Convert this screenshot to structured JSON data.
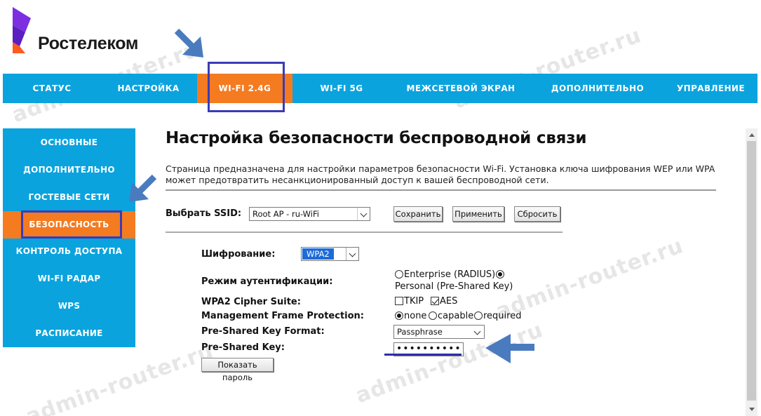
{
  "brand": {
    "name": "Ростелеком"
  },
  "topnav": {
    "items": [
      {
        "label": "СТАТУС"
      },
      {
        "label": "НАСТРОЙКА"
      },
      {
        "label": "WI-FI 2.4G"
      },
      {
        "label": "WI-FI 5G"
      },
      {
        "label": "МЕЖСЕТЕВОЙ ЭКРАН"
      },
      {
        "label": "ДОПОЛНИТЕЛЬНО"
      },
      {
        "label": "УПРАВЛЕНИЕ"
      }
    ],
    "active_index": 2
  },
  "sidebar": {
    "items": [
      {
        "label": "ОСНОВНЫЕ"
      },
      {
        "label": "ДОПОЛНИТЕЛЬНО"
      },
      {
        "label": "ГОСТЕВЫЕ СЕТИ"
      },
      {
        "label": "БЕЗОПАСНОСТЬ"
      },
      {
        "label": "КОНТРОЛЬ ДОСТУПА"
      },
      {
        "label": "WI-FI РАДАР"
      },
      {
        "label": "WPS"
      },
      {
        "label": "РАСПИСАНИЕ"
      }
    ],
    "active_index": 3
  },
  "page": {
    "title": "Настройка безопасности беспроводной связи",
    "description": "Страница предназначена для настройки параметров безопасности Wi-Fi. Установка ключа шифрования WEP или WPA может предотвратить несанкционированный доступ к вашей беспроводной сети."
  },
  "ssid": {
    "label": "Выбрать SSID:",
    "value": "Root AP - ru-WiFi",
    "save_label": "Сохранить",
    "apply_label": "Применить",
    "reset_label": "Сбросить"
  },
  "security": {
    "encryption_label": "Шифрование:",
    "encryption_value": "WPA2",
    "auth_label": "Режим аутентификации:",
    "auth_options": [
      "Enterprise (RADIUS)",
      "Personal (Pre-Shared Key)"
    ],
    "auth_selected": "Personal (Pre-Shared Key)",
    "cipher_label": "WPA2 Cipher Suite:",
    "cipher_options": [
      {
        "label": "TKIP",
        "checked": false
      },
      {
        "label": "AES",
        "checked": true
      }
    ],
    "mfp_label": "Management Frame Protection:",
    "mfp_options": [
      "none",
      "capable",
      "required"
    ],
    "mfp_selected": "none",
    "psk_format_label": "Pre-Shared Key Format:",
    "psk_format_value": "Passphrase",
    "psk_label": "Pre-Shared Key:",
    "psk_value": "••••••••••",
    "show_password_label": "Показать пароль"
  },
  "watermark": {
    "text": "admin-router.ru"
  },
  "colors": {
    "nav_bg": "#0aa3de",
    "active_bg": "#f47b20",
    "annotation": "#3b3bb7",
    "arrow": "#4a7bbf",
    "logo_purple": "#7b2fe0",
    "logo_orange": "#ff5a1f"
  }
}
